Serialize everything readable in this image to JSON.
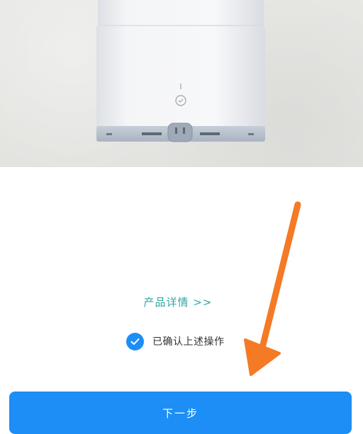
{
  "product_image": {
    "icon": "humidifier-device-image",
    "colors": {
      "background": "#e5e5e2",
      "device_body": "#f3f4f6",
      "device_base": "#b7c1cc"
    }
  },
  "details_link": {
    "label": "产品详情 >>"
  },
  "confirm": {
    "checked": true,
    "label": "已确认上述操作"
  },
  "next_button": {
    "label": "下一步"
  },
  "colors": {
    "accent_blue": "#1c8ef5",
    "link_teal": "#2fa8a4",
    "arrow_orange": "#f47a25"
  },
  "annotation": {
    "icon": "orange-arrow-pointer"
  }
}
